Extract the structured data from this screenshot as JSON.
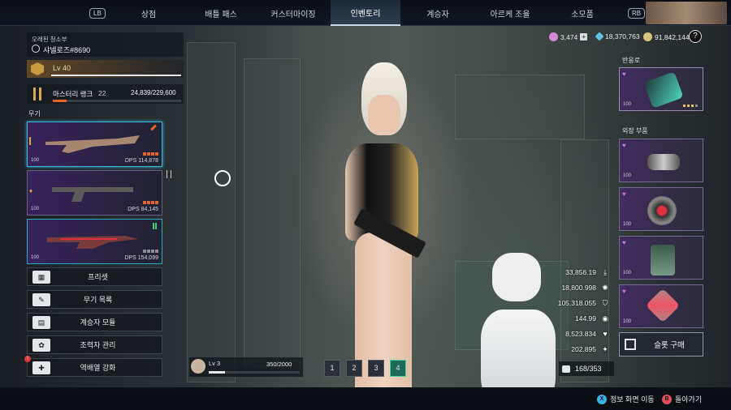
{
  "nav": {
    "lb": "LB",
    "rb": "RB",
    "tabs": [
      "상점",
      "배틀 패스",
      "커스터마이징",
      "인벤토리",
      "계승자",
      "아르케 조율",
      "소모품"
    ],
    "active_tab": 3
  },
  "currency": [
    {
      "value": "3,474",
      "icon": "gem-icon",
      "color": "#d08ad0",
      "plus": true
    },
    {
      "value": "18,370,763",
      "icon": "crystal-icon",
      "color": "#5fc0e0",
      "plus": false
    },
    {
      "value": "91,842,144",
      "icon": "coin-icon",
      "color": "#d9c27a",
      "plus": false
    }
  ],
  "help_label": "?",
  "profile": {
    "title": "오래된 청소부",
    "name": "샤넬로즈#8690",
    "level": "Lv 40",
    "mastery_label": "마스터리 랭크",
    "mastery_rank": "22",
    "mastery_progress": "24,839/229,600",
    "mastery_fraction": 0.108
  },
  "weapons_label": "무기",
  "weapons": [
    {
      "dps_label": "DPS",
      "dps": "114,878",
      "level": "100",
      "stars": 4,
      "star_color": "orange",
      "selected": true
    },
    {
      "dps_label": "DPS",
      "dps": "84,145",
      "level": "100",
      "stars": 4,
      "star_color": "orange",
      "selected": false
    },
    {
      "dps_label": "DPS",
      "dps": "154,099",
      "level": "100",
      "stars": 4,
      "star_color": "gray",
      "selected": false
    }
  ],
  "menu": [
    {
      "label": "프리셋",
      "icon": "preset-icon"
    },
    {
      "label": "무기 목록",
      "icon": "weapon-list-icon"
    },
    {
      "label": "계승자 모듈",
      "icon": "module-icon"
    },
    {
      "label": "조력자 관리",
      "icon": "paw-icon"
    },
    {
      "label": "역배열 강화",
      "icon": "reactor-icon"
    }
  ],
  "companion": {
    "level": "Lv 3",
    "xp": "350/2000",
    "xp_fraction": 0.175
  },
  "pages": [
    "1",
    "2",
    "3",
    "4"
  ],
  "active_page": 3,
  "stats": [
    {
      "value": "33,856.19",
      "icon": "arrow-down-icon"
    },
    {
      "value": "18,800.998",
      "icon": "sun-icon"
    },
    {
      "value": "105,318.055",
      "icon": "shield-icon"
    },
    {
      "value": "144.99",
      "icon": "circle-icon"
    },
    {
      "value": "8,523.834",
      "icon": "heart-icon"
    },
    {
      "value": "202.895",
      "icon": "sparkle-icon"
    }
  ],
  "inventory": {
    "count": "168/353"
  },
  "right_panel": {
    "reactor_label": "반응로",
    "parts_label": "외장 부품",
    "slot_level": "100",
    "buy_label": "슬롯 구매"
  },
  "hints": [
    {
      "button": "X",
      "label": "정보 화면 이동",
      "color": "#3ab2e8"
    },
    {
      "button": "B",
      "label": "돌아가기",
      "color": "#e0515a"
    }
  ]
}
